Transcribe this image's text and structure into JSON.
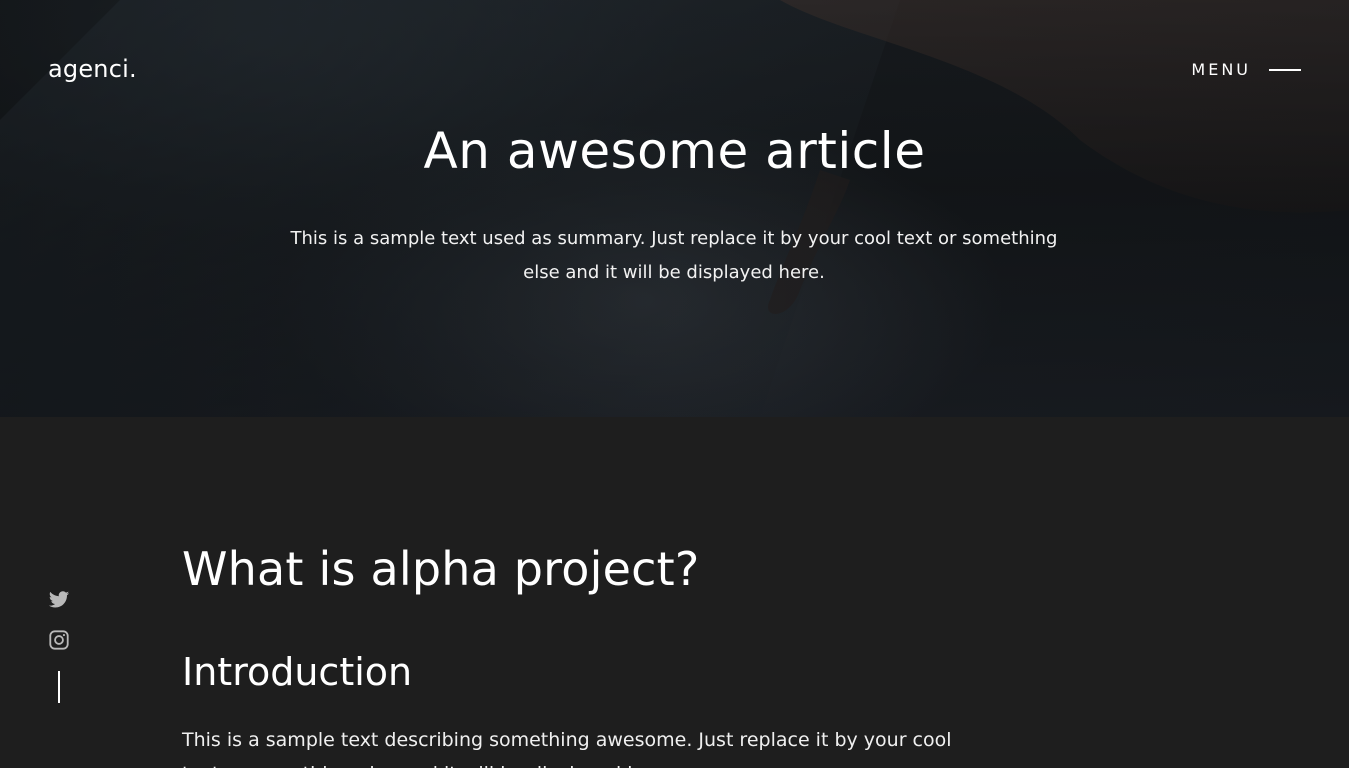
{
  "header": {
    "logo": "agenci.",
    "menu_label": "MENU"
  },
  "hero": {
    "title": "An awesome article",
    "summary": "This is a sample text used as summary. Just replace it by your cool text or something else and it will be displayed here."
  },
  "social": {
    "icons": [
      "twitter-icon",
      "instagram-icon"
    ]
  },
  "article": {
    "heading": "What is alpha project?",
    "subheading": "Introduction",
    "paragraph": "This is a sample text describing something awesome. Just replace it by your cool text or something else and it will be displayed here."
  },
  "colors": {
    "background": "#1e1e1e",
    "text": "#ffffff",
    "icon": "#b9b9b9"
  }
}
